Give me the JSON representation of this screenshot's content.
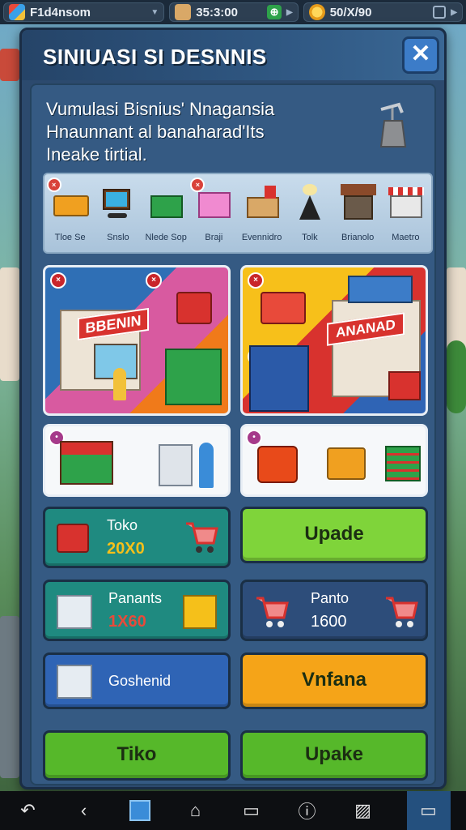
{
  "topbar": {
    "player_name": "F1d4nsom",
    "timer": "35:3:00",
    "gold": "50/X/90"
  },
  "panel": {
    "title": "SINIUASI SI DESNNIS",
    "close_label": "✕",
    "description": [
      "Vumulasi Bisnius' Nnagansia",
      "Hnaunnant al banaharad'Its",
      "Ineake tirtial."
    ]
  },
  "categories": [
    {
      "label": "Tloe Se",
      "badge": "×",
      "icon": "crate-icon"
    },
    {
      "label": "Snslo",
      "badge": "",
      "icon": "cart-icon"
    },
    {
      "label": "Nlede Sop",
      "badge": "",
      "icon": "green-box-icon"
    },
    {
      "label": "Braji",
      "badge": "×",
      "icon": "pink-box-icon"
    },
    {
      "label": "Evennidro",
      "badge": "",
      "icon": "cardboard-box-icon"
    },
    {
      "label": "Tolk",
      "badge": "",
      "icon": "bag-icon"
    },
    {
      "label": "Brianolo",
      "badge": "",
      "icon": "house-icon"
    },
    {
      "label": "Maetro",
      "badge": "",
      "icon": "store-icon"
    }
  ],
  "scenes": [
    {
      "sign": "BBENIN",
      "badge": "×"
    },
    {
      "sign": "ANANAD",
      "badge": "×"
    }
  ],
  "stats": {
    "toko": {
      "title": "Toko",
      "value": "20X0"
    },
    "panans": {
      "title": "Panants",
      "value": "1X60"
    },
    "panto": {
      "title": "Panto",
      "value": "1600"
    },
    "goshenid": {
      "title": "Goshenid"
    }
  },
  "buttons": {
    "upade": "Upade",
    "vnfana": "Vnfana",
    "tiko": "Tiko",
    "upake": "Upake"
  },
  "colors": {
    "green_btn": "#7fd43a",
    "orange_btn": "#f5a418",
    "teal_card": "#1f8a80",
    "navy_card": "#2d4d7a",
    "blue_card": "#2f64b5"
  }
}
